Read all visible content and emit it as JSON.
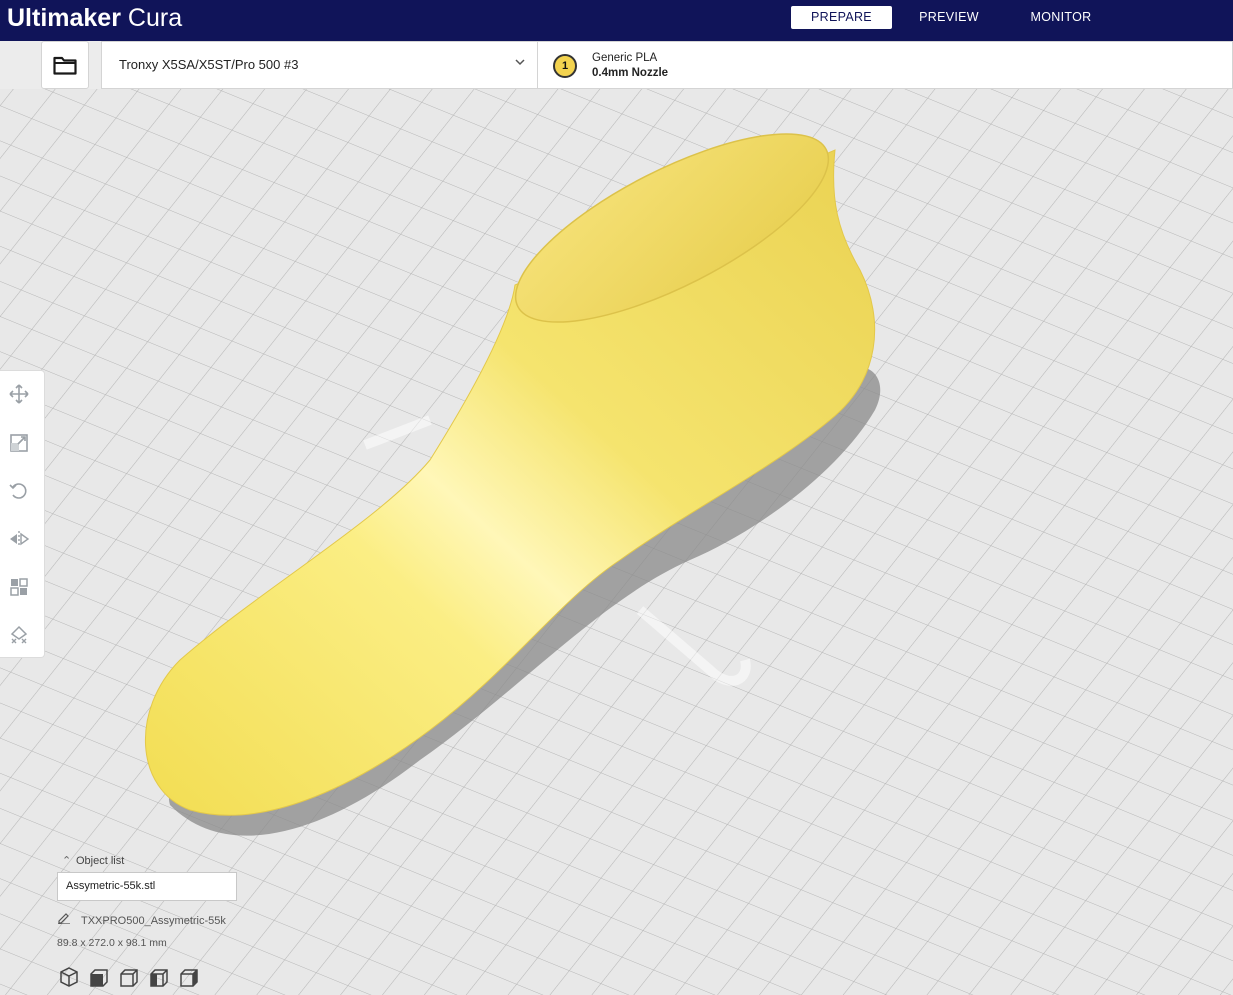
{
  "app": {
    "brand_bold": "Ultimaker",
    "brand_light": "Cura"
  },
  "stages": [
    {
      "label": "PREPARE",
      "active": true
    },
    {
      "label": "PREVIEW",
      "active": false
    },
    {
      "label": "MONITOR",
      "active": false
    }
  ],
  "machine": {
    "name": "Tronxy X5SA/X5ST/Pro 500 #3"
  },
  "extruder": {
    "number": "1",
    "material": "Generic PLA",
    "nozzle": "0.4mm Nozzle",
    "color": "#f3d34f"
  },
  "tools": [
    "move-icon",
    "scale-icon",
    "rotate-icon",
    "mirror-icon",
    "per-model-settings-icon",
    "support-blocker-icon"
  ],
  "object_list": {
    "toggle_label": "Object list",
    "file": "Assymetric-55k.stl",
    "job_name": "TXXPRO500_Assymetric-55k",
    "dimensions": "89.8 x 272.0 x 98.1 mm"
  },
  "view_buttons": [
    "3d-view-icon",
    "front-view-icon",
    "top-view-icon",
    "left-view-icon",
    "right-view-icon"
  ],
  "colors": {
    "header": "#101459",
    "model": "#f3e36a",
    "plate": "#e9e9e9",
    "grid": "#b9b9b9"
  }
}
